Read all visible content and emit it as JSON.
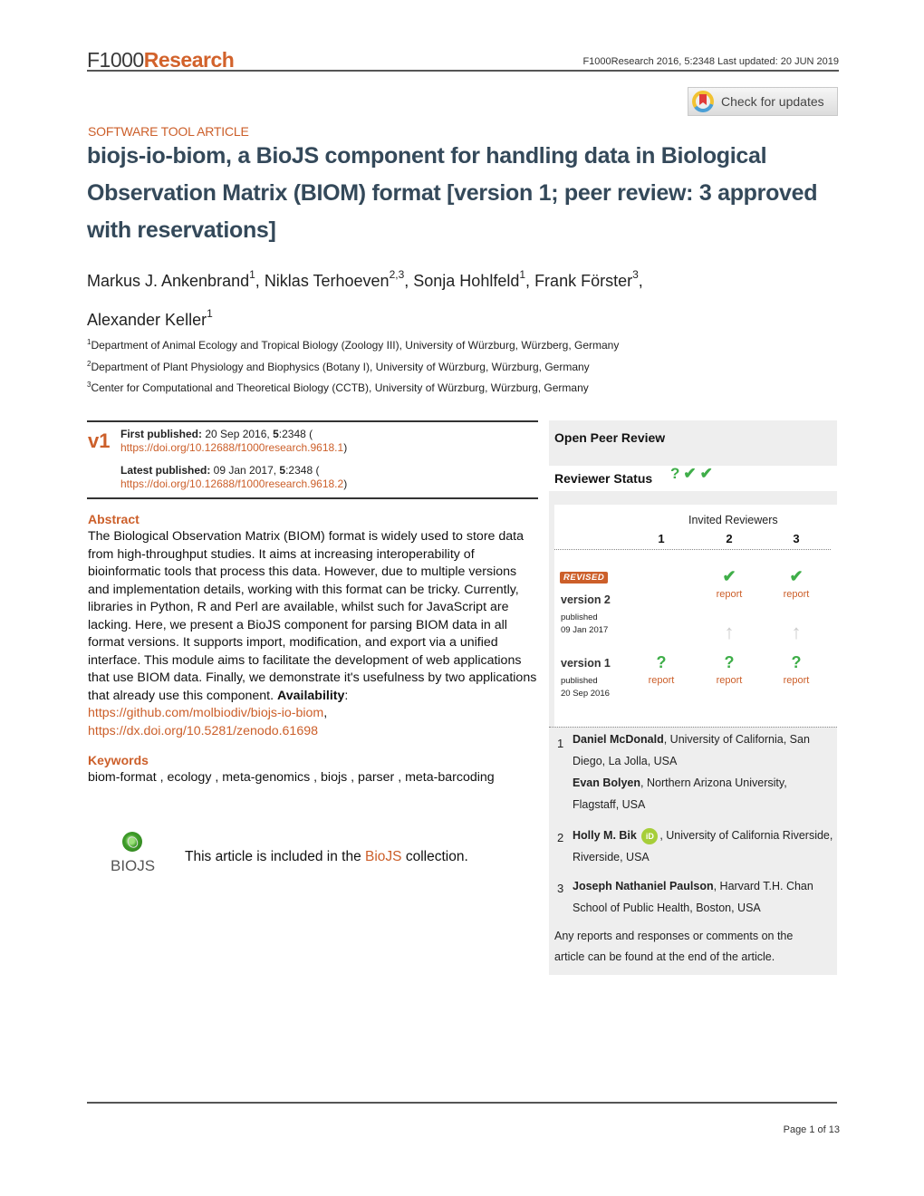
{
  "header": {
    "logo_part1": "F1000",
    "logo_part2": "Research",
    "meta": "F1000Research 2016, 5:2348 Last updated: 20 JUN 2019",
    "check_updates_label": "Check for updates"
  },
  "article": {
    "type": "SOFTWARE TOOL ARTICLE",
    "title": "biojs-io-biom, a BioJS component for handling data in Biological Observation Matrix (BIOM) format",
    "version_note": "[version 1; peer review: 3 approved with reservations]",
    "authors": [
      {
        "name": "Markus J. Ankenbrand",
        "affil": "1",
        "sep": ", "
      },
      {
        "name": "Niklas Terhoeven",
        "affil": "2,3",
        "sep": ", "
      },
      {
        "name": "Sonja Hohlfeld",
        "affil": "1",
        "sep": ", "
      },
      {
        "name": "Frank Förster",
        "affil": "3",
        "sep": ","
      },
      {
        "name": "Alexander Keller",
        "affil": "1",
        "sep": ""
      }
    ],
    "affiliations": [
      {
        "num": "1",
        "text": "Department of Animal Ecology and Tropical Biology (Zoology III), University of Würzburg, Würzberg, Germany"
      },
      {
        "num": "2",
        "text": "Department of Plant Physiology and Biophysics (Botany I), University of Würzburg, Würzburg, Germany"
      },
      {
        "num": "3",
        "text": "Center for Computational and Theoretical Biology (CCTB), University of Würzburg, Würzburg, Germany"
      }
    ]
  },
  "publication": {
    "version_badge": "v1",
    "first_label": "First published:",
    "first_date": " 20 Sep 2016, ",
    "first_vol": "5",
    "first_id": ":2348 (",
    "first_doi": "https://doi.org/10.12688/f1000research.9618.1",
    "latest_label": "Latest published:",
    "latest_date": " 09 Jan 2017, ",
    "latest_vol": "5",
    "latest_id": ":2348 (",
    "latest_doi": "https://doi.org/10.12688/f1000research.9618.2",
    "close_paren": ")"
  },
  "abstract": {
    "heading": "Abstract",
    "text": "The Biological Observation Matrix (BIOM) format is widely used to store data from high-throughput studies. It aims at increasing interoperability of bioinformatic tools that process this data. However, due to multiple versions and implementation details, working with this format can be tricky. Currently, libraries in Python, R and Perl are available, whilst such for JavaScript are lacking. Here, we present a BioJS component for parsing BIOM data in all format versions. It supports import, modification, and export via a unified interface. This module aims to facilitate the development of web applications that use BIOM data. Finally, we demonstrate it's usefulness by two applications that already use this component. ",
    "availability_label": "Availability",
    "availability_colon": ": ",
    "link1": "https://github.com/molbiodiv/biojs-io-biom",
    "comma": ",",
    "link2": "https://dx.doi.org/10.5281/zenodo.61698"
  },
  "keywords": {
    "heading": "Keywords",
    "text": "biom-format , ecology , meta-genomics , biojs , parser , meta-barcoding"
  },
  "collection": {
    "logo_text": "BIOJS",
    "prefix": "This article is included in the ",
    "link": "BioJS",
    "suffix": " collection."
  },
  "peer_review": {
    "title": "Open Peer Review",
    "status_label": "Reviewer Status",
    "status_icons": [
      "?",
      "✔",
      "✔"
    ],
    "invited_label": "Invited Reviewers",
    "columns": [
      "1",
      "2",
      "3"
    ],
    "revised_badge": "REVISED",
    "versions": [
      {
        "label": "version 2",
        "published": "published",
        "date": "09 Jan 2017",
        "cells": [
          {
            "mark": "",
            "report": ""
          },
          {
            "mark": "✔",
            "report": "report"
          },
          {
            "mark": "✔",
            "report": "report"
          }
        ]
      },
      {
        "label": "version 1",
        "published": "published",
        "date": "20 Sep 2016",
        "cells": [
          {
            "mark": "?",
            "report": "report"
          },
          {
            "mark": "?",
            "report": "report"
          },
          {
            "mark": "?",
            "report": "report"
          }
        ]
      }
    ],
    "reviewers": [
      {
        "num": "1",
        "entries": [
          {
            "name": "Daniel McDonald",
            "affil": ", University of California, San Diego, La Jolla, USA"
          },
          {
            "name": "Evan Bolyen",
            "affil": ", Northern Arizona University, Flagstaff, USA"
          }
        ]
      },
      {
        "num": "2",
        "entries": [
          {
            "name": "Holly M. Bik",
            "orcid": "iD",
            "affil": ", University of California Riverside, Riverside, USA"
          }
        ]
      },
      {
        "num": "3",
        "entries": [
          {
            "name": "Joseph Nathaniel Paulson",
            "affil": ", Harvard T.H. Chan School of Public Health, Boston, USA"
          }
        ]
      }
    ],
    "note": "Any reports and responses or comments on the article can be found at the end of the article."
  },
  "footer": {
    "page": "Page 1 of 13"
  }
}
